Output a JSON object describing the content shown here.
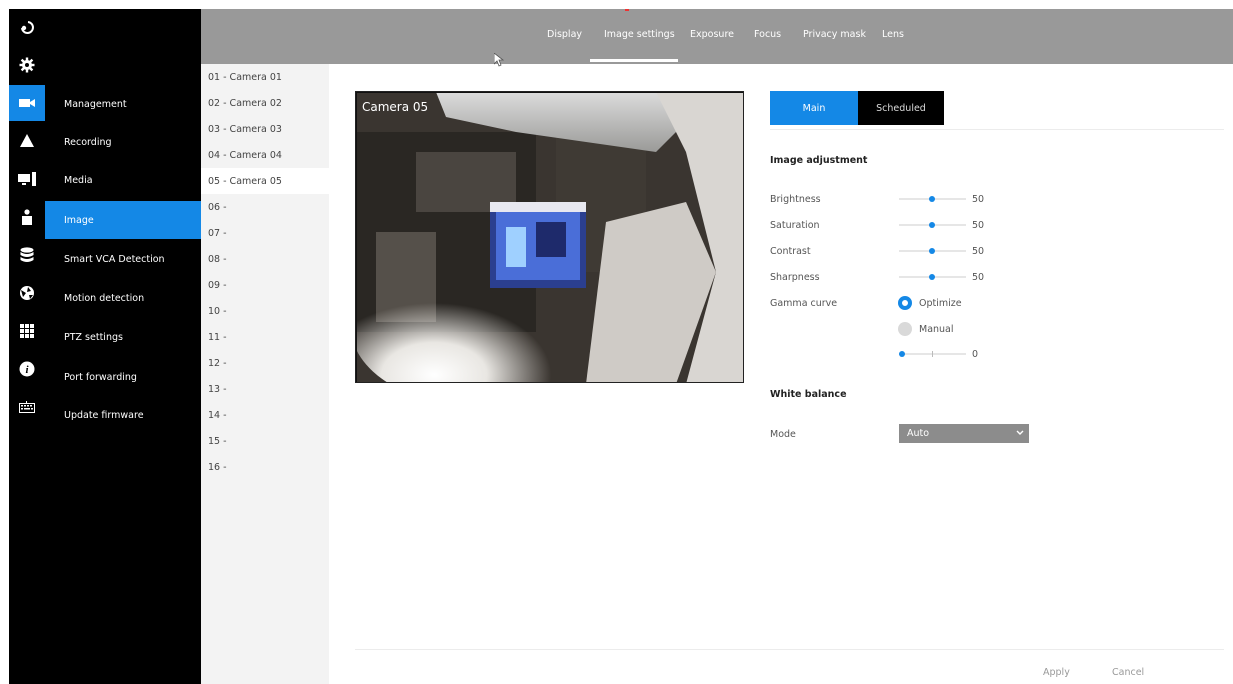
{
  "tabs": [
    {
      "label": "Display",
      "active": false
    },
    {
      "label": "Image settings",
      "active": true
    },
    {
      "label": "Exposure",
      "active": false
    },
    {
      "label": "Focus",
      "active": false
    },
    {
      "label": "Privacy mask",
      "active": false
    },
    {
      "label": "Lens",
      "active": false
    }
  ],
  "rail_icons": [
    "logout-icon",
    "gear-icon",
    "camera-icon",
    "alert-icon",
    "display-icon",
    "user-icon",
    "database-icon",
    "network-icon",
    "grid-icon",
    "info-icon",
    "keyboard-icon"
  ],
  "active_rail_icon": "camera-icon",
  "sidebar": {
    "items": [
      {
        "label": "Management"
      },
      {
        "label": "Recording"
      },
      {
        "label": "Media"
      },
      {
        "label": "Image",
        "active": true
      },
      {
        "label": "Smart VCA Detection"
      },
      {
        "label": "Motion detection"
      },
      {
        "label": "PTZ settings"
      },
      {
        "label": "Port forwarding"
      },
      {
        "label": "Update firmware"
      }
    ]
  },
  "cameras": {
    "items": [
      "01 - Camera 01",
      "02 - Camera 02",
      "03 - Camera 03",
      "04 - Camera 04",
      "05 - Camera 05",
      "06 -",
      "07 -",
      "08 -",
      "09 -",
      "10 -",
      "11 -",
      "12 -",
      "13 -",
      "14 -",
      "15 -",
      "16 -"
    ],
    "selected": "05 - Camera 05"
  },
  "video": {
    "overlay": "Camera 05"
  },
  "segment": {
    "main": "Main",
    "scheduled": "Scheduled",
    "selected": "Main"
  },
  "image_adjustment": {
    "title": "Image adjustment",
    "brightness": {
      "label": "Brightness",
      "value": "50"
    },
    "saturation": {
      "label": "Saturation",
      "value": "50"
    },
    "contrast": {
      "label": "Contrast",
      "value": "50"
    },
    "sharpness": {
      "label": "Sharpness",
      "value": "50"
    },
    "gamma": {
      "label": "Gamma curve",
      "optimize": "Optimize",
      "manual": "Manual",
      "selected": "Optimize",
      "value": "0"
    }
  },
  "white_balance": {
    "title": "White balance",
    "mode_label": "Mode",
    "mode_value": "Auto"
  },
  "footer": {
    "apply": "Apply",
    "cancel": "Cancel"
  },
  "colors": {
    "accent": "#1488e6",
    "topbar": "#999999",
    "sidebar": "#000000",
    "camera_list": "#f3f3f3"
  }
}
